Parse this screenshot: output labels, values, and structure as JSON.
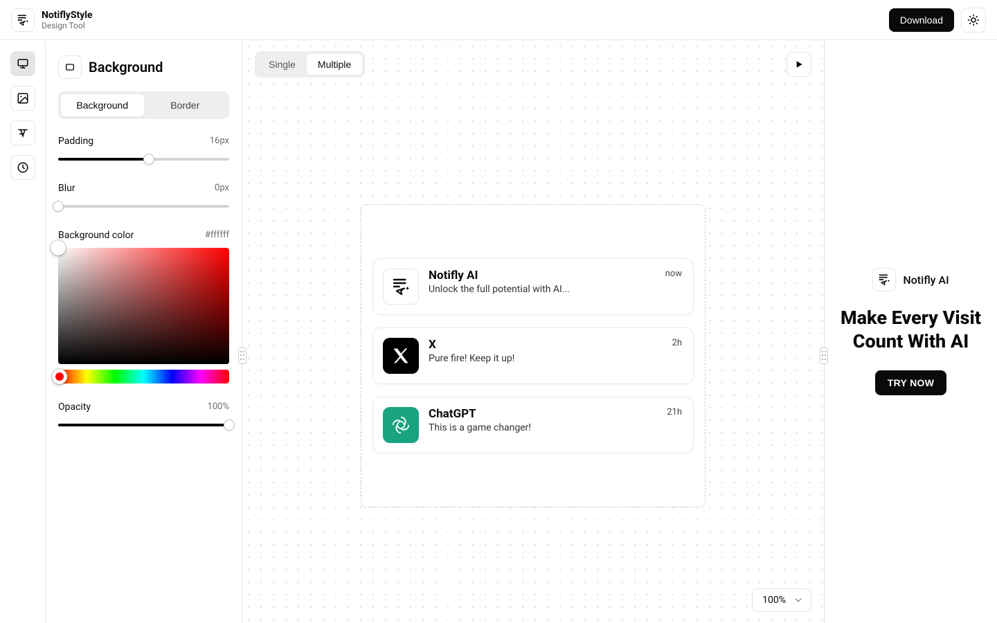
{
  "header": {
    "brand_title": "NotiflyStyle",
    "brand_subtitle": "Design Tool",
    "download_label": "Download"
  },
  "rail": {
    "items": [
      "background",
      "image",
      "text",
      "history"
    ]
  },
  "sidebar": {
    "section_title": "Background",
    "tabs": {
      "background": "Background",
      "border": "Border",
      "active": "background"
    },
    "padding": {
      "label": "Padding",
      "value": "16px",
      "pct": 53
    },
    "blur": {
      "label": "Blur",
      "value": "0px",
      "pct": 0
    },
    "bgcolor": {
      "label": "Background color",
      "hex": "#ffffff",
      "hue": "#ff0000",
      "thumb_x": 0,
      "thumb_y": 0
    },
    "opacity": {
      "label": "Opacity",
      "value": "100%",
      "pct": 100
    }
  },
  "canvas": {
    "modes": {
      "single": "Single",
      "multiple": "Multiple",
      "active": "multiple"
    },
    "zoom": "100%",
    "notifications": [
      {
        "icon": "notifly",
        "title": "Notifly AI",
        "message": "Unlock the full potential with AI...",
        "time": "now"
      },
      {
        "icon": "x",
        "title": "X",
        "message": "Pure fire! Keep it up!",
        "time": "2h"
      },
      {
        "icon": "chatgpt",
        "title": "ChatGPT",
        "message": "This is a game changer!",
        "time": "21h"
      }
    ]
  },
  "promo": {
    "brand": "Notifly AI",
    "heading": "Make Every Visit Count With AI",
    "cta": "TRY NOW"
  }
}
